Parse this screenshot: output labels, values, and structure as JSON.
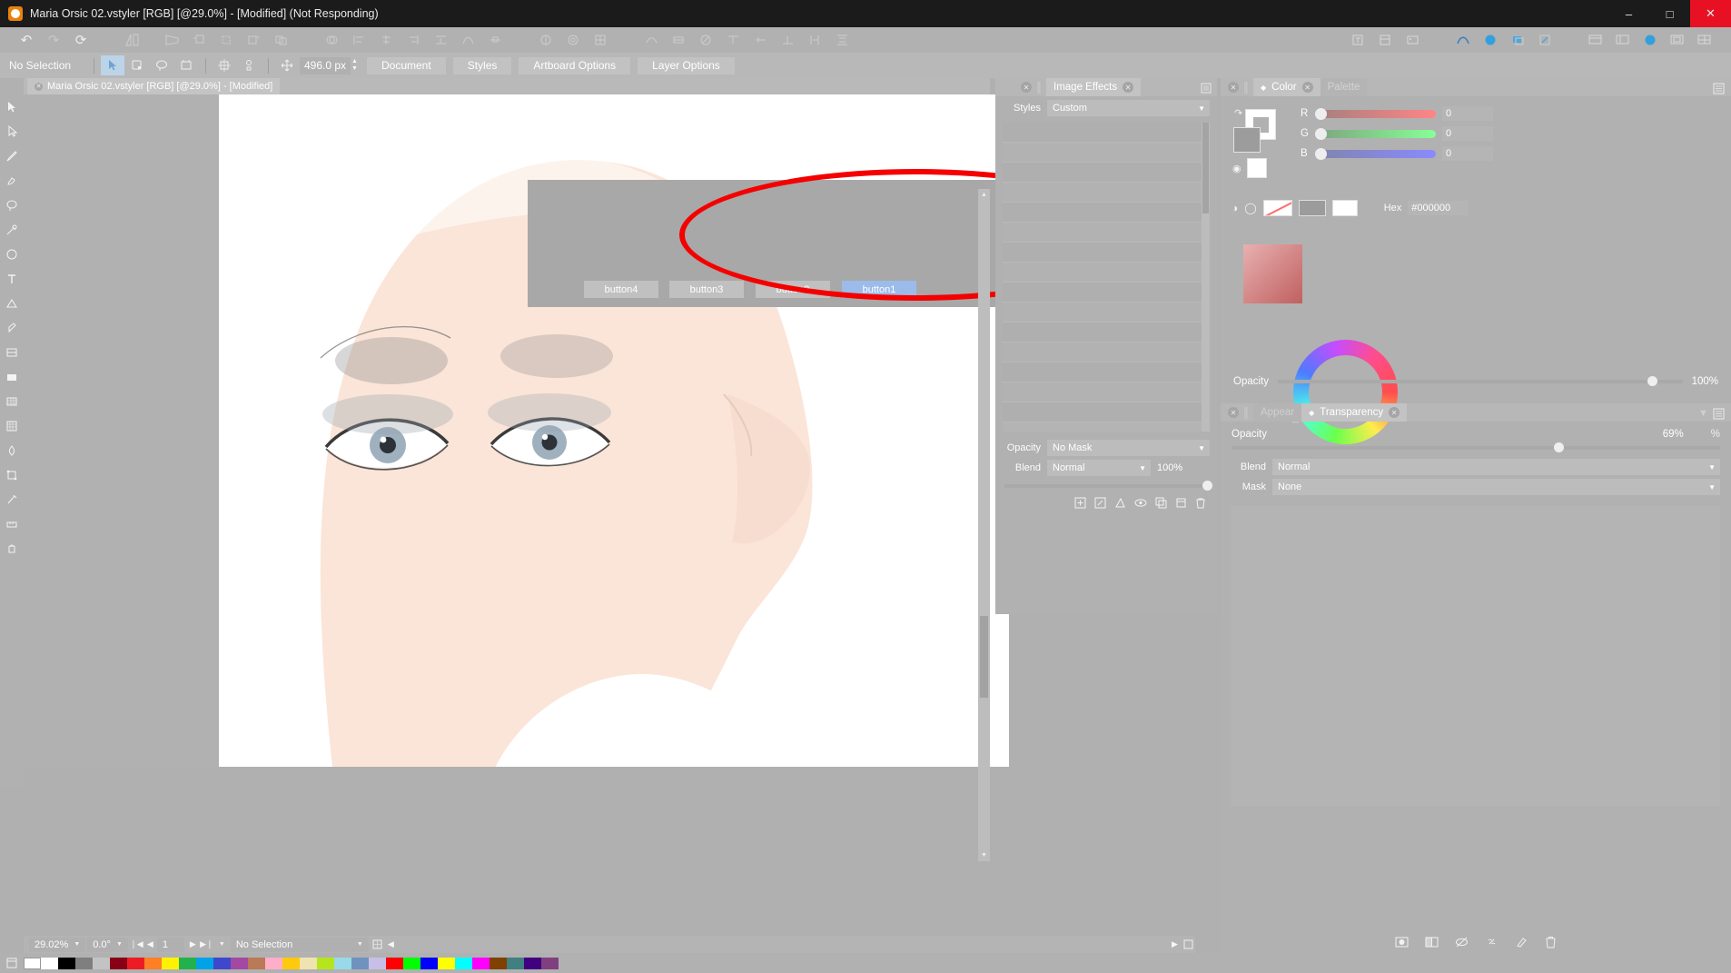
{
  "window": {
    "title": "Maria Orsic 02.vstyler [RGB] [@29.0%] - [Modified] (Not Responding)",
    "icon": "app-icon",
    "minimize": "–",
    "maximize": "□",
    "close": "✕"
  },
  "toolbar": {
    "undo": "↶",
    "redo": "↷",
    "refresh": "⟳"
  },
  "options": {
    "selection_status": "No Selection",
    "size_value": "496.0 px",
    "buttons": [
      {
        "label": "Document"
      },
      {
        "label": "Styles"
      },
      {
        "label": "Artboard Options"
      },
      {
        "label": "Layer Options"
      }
    ]
  },
  "document_tab": {
    "label": "Maria Orsic 02.vstyler [RGB] [@29.0%] - [Modified]",
    "close": "✕"
  },
  "canvas": {
    "widget_buttons": [
      {
        "label": "button4",
        "selected": false
      },
      {
        "label": "button3",
        "selected": false
      },
      {
        "label": "button2",
        "selected": false
      },
      {
        "label": "button1",
        "selected": true
      }
    ],
    "annotation": "red-ellipse-highlight",
    "annotation_color": "#f40000"
  },
  "image_effects": {
    "tab_label": "Image Effects",
    "tab_close": "✕",
    "styles_label": "Styles",
    "styles_value": "Custom",
    "opacity_label": "Opacity",
    "opacity_value": "No Mask",
    "blend_label": "Blend",
    "blend_value": "Normal",
    "blend_percent": "100%",
    "tool_icons": [
      "add-effect-icon",
      "edit-effect-icon",
      "transform-effect-icon",
      "visibility-icon",
      "duplicate-icon",
      "copy-icon",
      "delete-icon"
    ]
  },
  "color_panel": {
    "tab_color": "Color",
    "tab_palette": "Palette",
    "tab_close": "✕",
    "menu_icon": "hamburger-icon",
    "channels": [
      {
        "name": "R",
        "value": "0"
      },
      {
        "name": "G",
        "value": "0"
      },
      {
        "name": "B",
        "value": "0"
      }
    ],
    "hex_label": "Hex",
    "hex_value": "#000000",
    "opacity_label": "Opacity",
    "opacity_value": "100%"
  },
  "transparency_panel": {
    "tab_appearance": "Appear",
    "tab_transparency": "Transparency",
    "tab_close": "✕",
    "opacity_label": "Opacity",
    "opacity_value": "69%",
    "opacity_unit": "%",
    "blend_label": "Blend",
    "blend_value": "Normal",
    "mask_label": "Mask",
    "mask_value": "None",
    "bottom_icons": [
      "add-mask-icon",
      "invert-mask-icon",
      "hide-icon",
      "link-icon",
      "clear-icon",
      "delete-icon"
    ]
  },
  "statusbar": {
    "zoom": "29.02%",
    "rotation": "0.0°",
    "page": "1",
    "selection": "No Selection",
    "first_icon": "❘◀",
    "prev_icon": "◀",
    "next_icon": "▶",
    "last_icon": "▶❘"
  },
  "palette_strip": {
    "colors": [
      "#ffffff",
      "#000000",
      "#7f7f7f",
      "#c3c3c3",
      "#880015",
      "#ed1c24",
      "#ff7f27",
      "#fff200",
      "#22b14c",
      "#00a2e8",
      "#3f48cc",
      "#a349a4",
      "#b97a57",
      "#ffaec9",
      "#ffc90e",
      "#efe4b0",
      "#b5e61d",
      "#99d9ea",
      "#7092be",
      "#c8bfe7",
      "#ff0000",
      "#00ff00",
      "#0000ff",
      "#ffff00",
      "#00ffff",
      "#ff00ff",
      "#804000",
      "#408080",
      "#400080",
      "#804080"
    ]
  }
}
